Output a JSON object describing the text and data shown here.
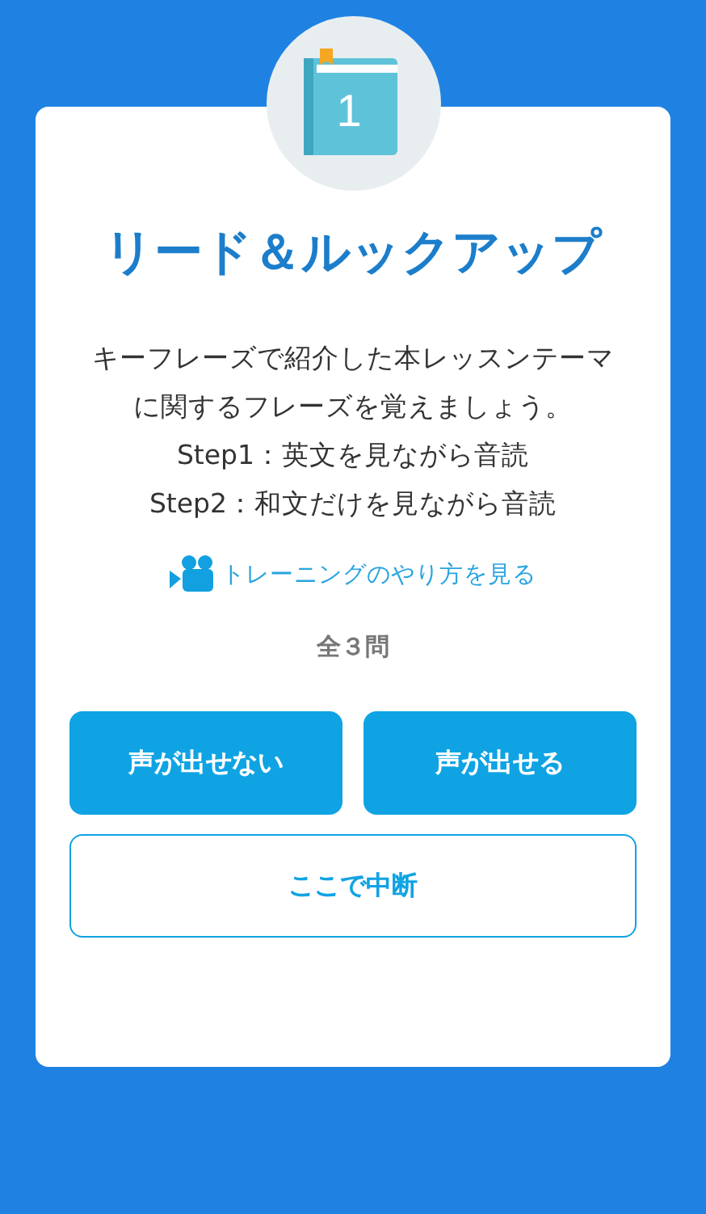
{
  "title": "リード＆ルックアップ",
  "description": "キーフレーズで紹介した本レッスンテーマに関するフレーズを覚えましょう。\nStep1：英文を見ながら音読\nStep2：和文だけを見ながら音読",
  "book_number": "1",
  "video_link": "トレーニングのやり方を見る",
  "count": "全３問",
  "buttons": [
    {
      "label": "声が出せない",
      "kind": "filled"
    },
    {
      "label": "声が出せる",
      "kind": "filled"
    },
    {
      "label": "ここで中断",
      "kind": "outline"
    }
  ]
}
